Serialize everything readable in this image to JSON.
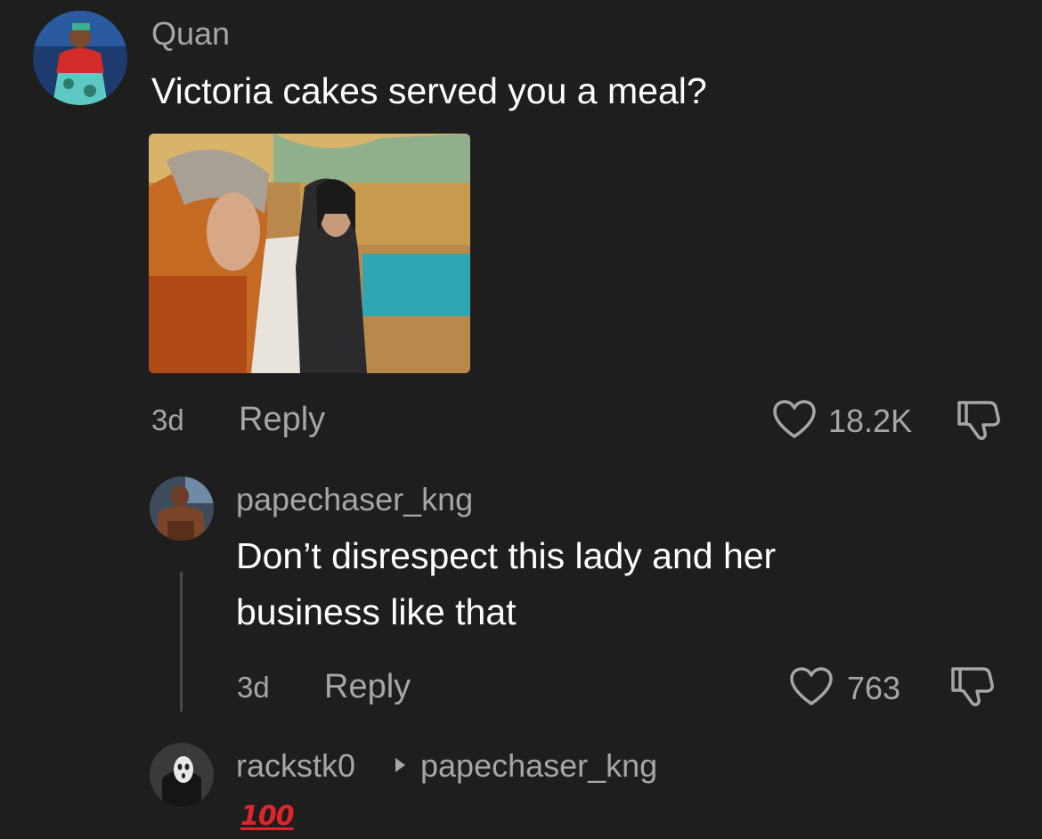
{
  "comments": [
    {
      "username": "Quan",
      "text": "Victoria cakes served you a meal?",
      "time": "3d",
      "reply_label": "Reply",
      "likes": "18.2K",
      "has_media": true
    },
    {
      "username": "papechaser_kng",
      "text_lines": [
        "Don’t disrespect this lady and her",
        "business like that"
      ],
      "time": "3d",
      "reply_label": "Reply",
      "likes": "763"
    },
    {
      "username": "rackstk0",
      "reply_to": "papechaser_kng",
      "text": "100"
    }
  ],
  "colors": {
    "background": "#1e1e1e",
    "primary_text": "#ffffff",
    "secondary_text": "#a6a6a6",
    "thread_line": "#4a4a4a",
    "emoji_red": "#e0242b"
  },
  "icons": {
    "like": "heart-outline-icon",
    "dislike": "thumbs-down-outline-icon",
    "reply_to": "triangle-right-icon",
    "emoji": "hundred-points-emoji"
  }
}
